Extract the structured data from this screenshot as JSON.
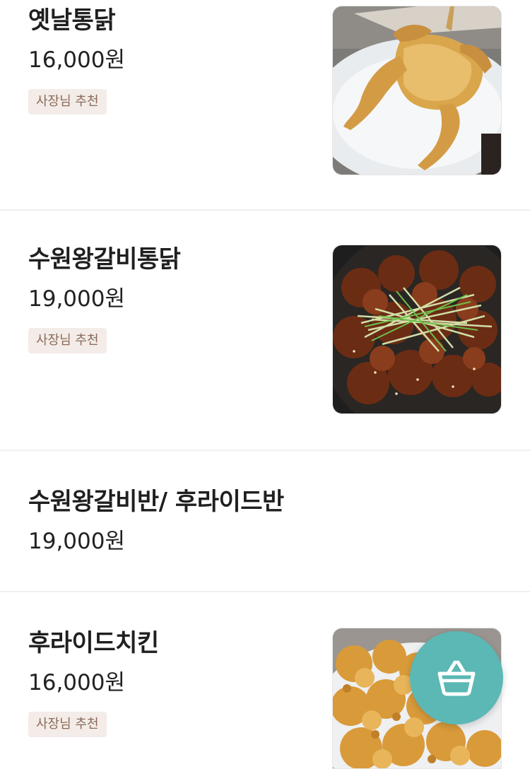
{
  "menu": {
    "items": [
      {
        "name": "옛날통닭",
        "price": "16,000원",
        "badge": "사장님 추천",
        "image_icon": "roast-whole-chicken-photo"
      },
      {
        "name": "수원왕갈비통닭",
        "price": "19,000원",
        "badge": "사장님 추천",
        "image_icon": "galbi-glazed-chicken-photo"
      },
      {
        "name": "수원왕갈비반/ 후라이드반",
        "price": "19,000원"
      },
      {
        "name": "후라이드치킨",
        "price": "16,000원",
        "badge": "사장님 추천",
        "image_icon": "fried-chicken-photo"
      }
    ]
  },
  "cart": {
    "icon": "basket-icon"
  },
  "colors": {
    "accent": "#5bb8b4",
    "badge_bg": "#f3ece8",
    "badge_text": "#8a6a58",
    "divider": "#f0f0f0"
  }
}
